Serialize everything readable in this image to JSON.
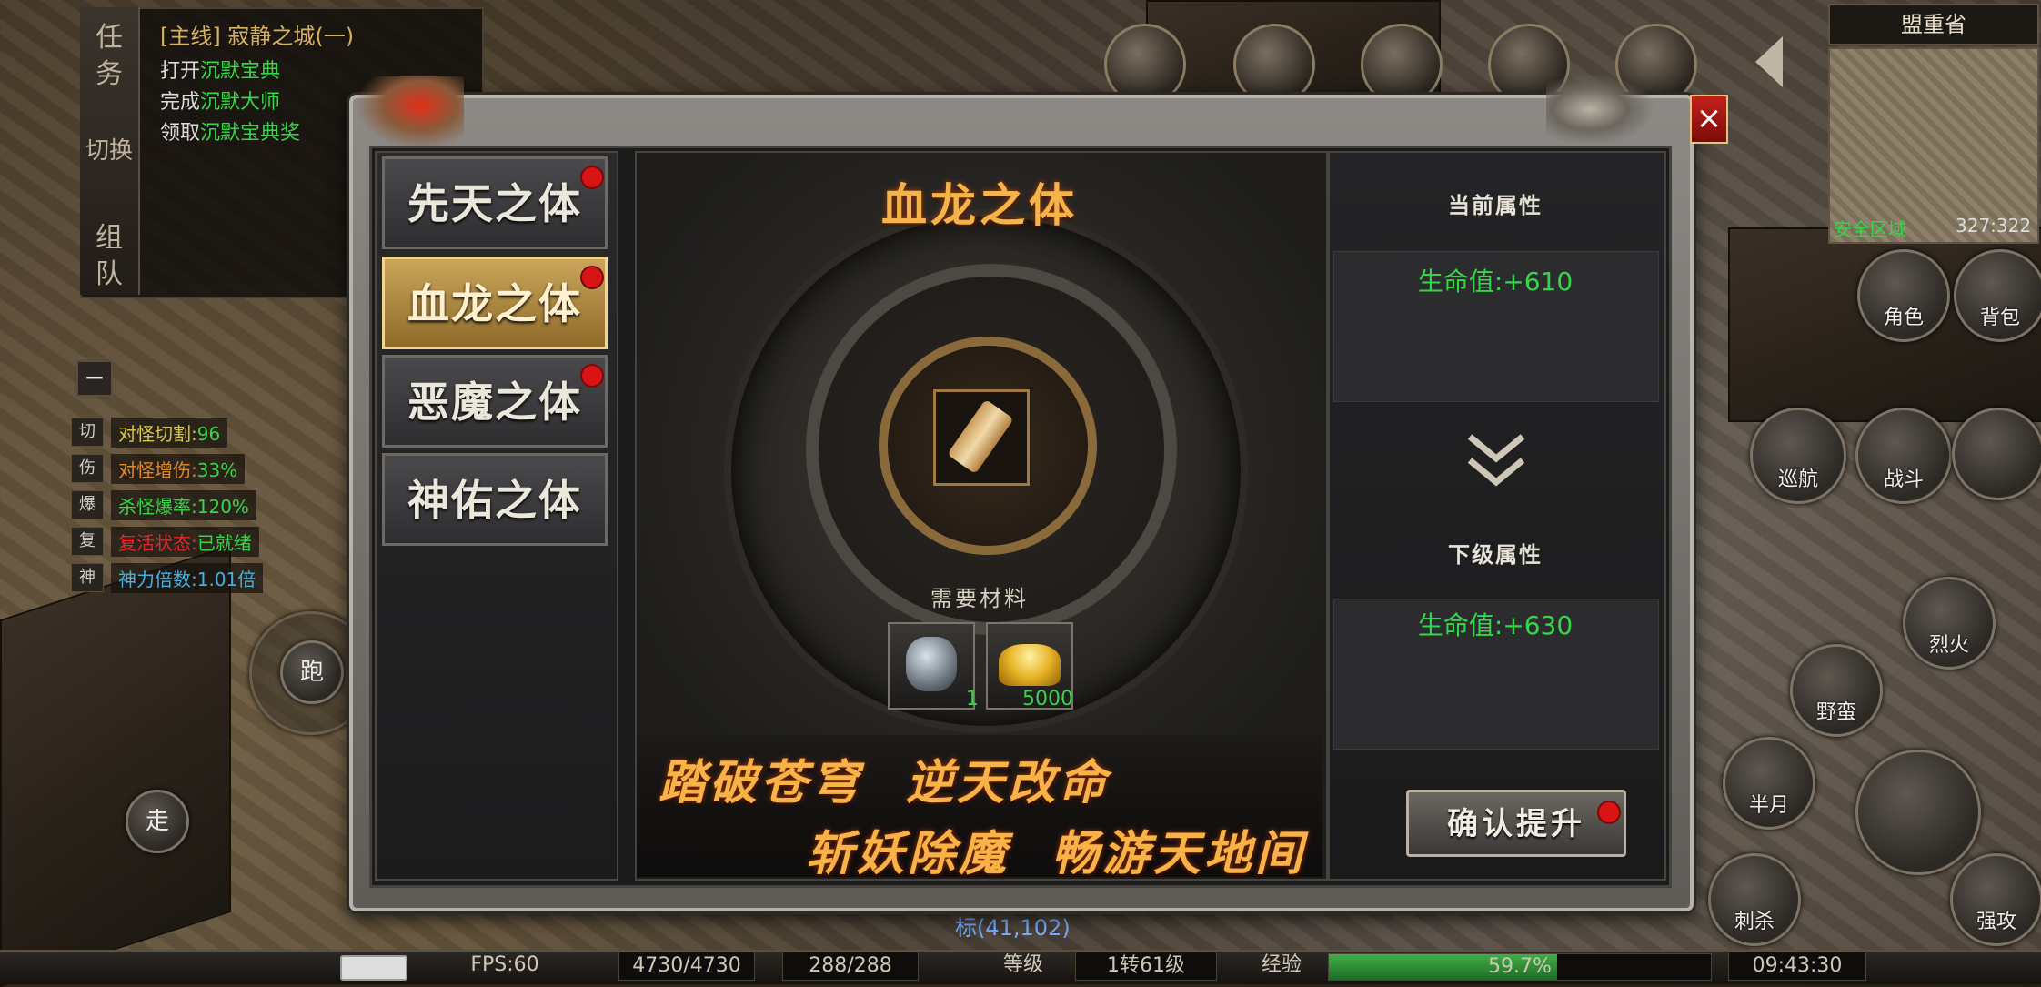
{
  "quest": {
    "side_tab_1": "任务",
    "side_tab_2": "切换",
    "side_tab_3": "组队",
    "title": "[主线] 寂静之城(一)",
    "lines": [
      {
        "prefix": "打开",
        "target": "沉默宝典"
      },
      {
        "prefix": "完成",
        "target": "沉默大师"
      },
      {
        "prefix": "领取",
        "target": "沉默宝典奖"
      }
    ]
  },
  "stats": [
    {
      "key": "切",
      "label": "对怪切割:",
      "value": "96",
      "label_color": "#d6c74a",
      "value_color": "#35d64a"
    },
    {
      "key": "伤",
      "label": "对怪增伤:",
      "value": "33%",
      "label_color": "#e08a2c",
      "value_color": "#35d64a"
    },
    {
      "key": "爆",
      "label": "杀怪爆率:",
      "value": "120%",
      "label_color": "#35d64a",
      "value_color": "#35d64a"
    },
    {
      "key": "复",
      "label": "复活状态:",
      "value": "已就绪",
      "label_color": "#e02a2a",
      "value_color": "#35d64a"
    },
    {
      "key": "神",
      "label": "神力倍数:",
      "value": "1.01倍",
      "label_color": "#3fb2e8",
      "value_color": "#3fb2e8"
    }
  ],
  "collapse_btn": "−",
  "map": {
    "name": "盟重省",
    "zone": "安全区域",
    "coords": "327:322"
  },
  "right_buttons": {
    "role": "角色",
    "bag": "背包",
    "patrol": "巡航",
    "fight": "战斗"
  },
  "skills": [
    "烈火",
    "野蛮",
    "半月",
    "刺杀",
    "强攻"
  ],
  "left_controls": {
    "run": "跑",
    "walk": "走"
  },
  "scene_text": "标(41,102)",
  "dialog": {
    "close": "×",
    "tabs": [
      {
        "label": "先天之体",
        "dot": true
      },
      {
        "label": "血龙之体",
        "dot": true,
        "active": true
      },
      {
        "label": "恶魔之体",
        "dot": true
      },
      {
        "label": "神佑之体",
        "dot": false
      }
    ],
    "title": "血龙之体",
    "materials_title": "需要材料",
    "materials": [
      {
        "icon": "gem-ring-icon",
        "count": "1"
      },
      {
        "icon": "gold-ingot-icon",
        "count": "5000"
      }
    ],
    "slogans": [
      "踏破苍穹",
      "逆天改命",
      "斩妖除魔",
      "畅游天地间"
    ],
    "current_attr_title": "当前属性",
    "current_attr_value": "生命值:+610",
    "next_attr_title": "下级属性",
    "next_attr_value": "生命值:+630",
    "confirm_label": "确认提升"
  },
  "bottom_bar": {
    "fps": "FPS:60",
    "hp": "4730/4730",
    "mp": "288/288",
    "level_label": "等级",
    "level": "1转61级",
    "exp_label": "经验",
    "exp_percent": "59.7%",
    "exp_fraction": 0.597,
    "time": "09:43:30"
  }
}
